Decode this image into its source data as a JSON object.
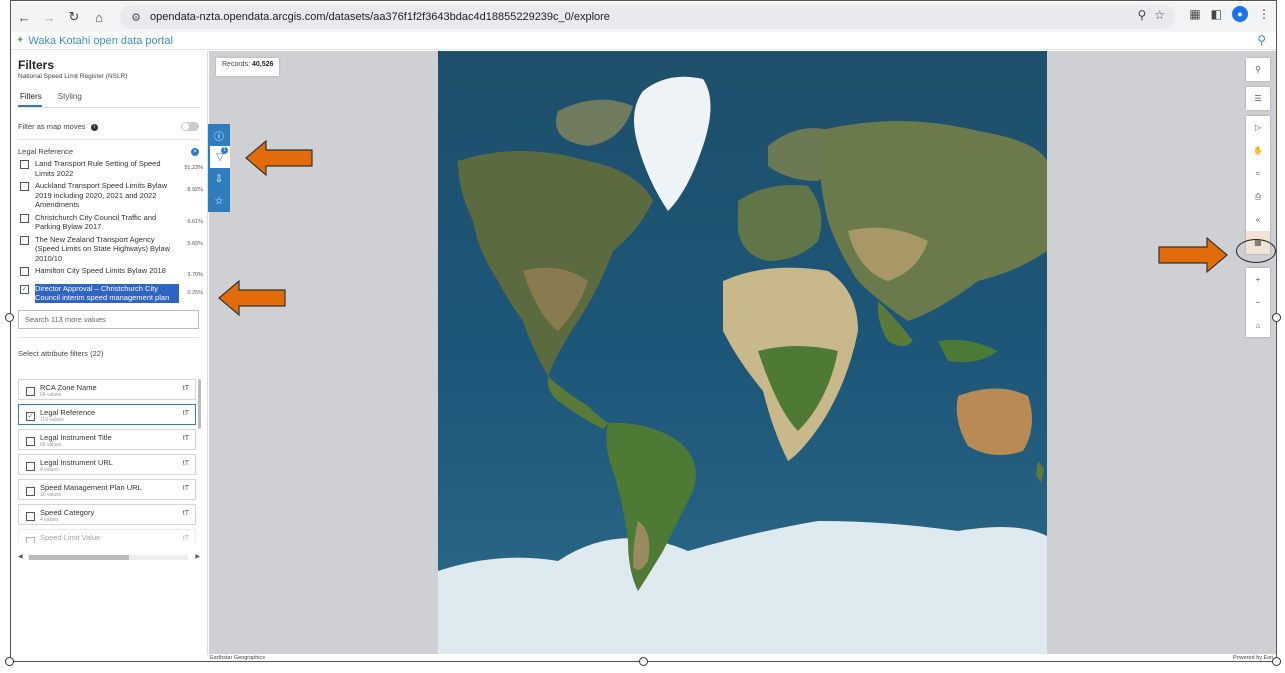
{
  "browser": {
    "url": "opendata-nzta.opendata.arcgis.com/datasets/aa376f1f2f3643bdac4d18855229239c_0/explore",
    "icons": [
      "back-icon",
      "forward-icon",
      "reload-icon",
      "home-icon",
      "site-settings-icon",
      "zoom-icon",
      "star-icon",
      "extensions-icon",
      "sidepanel-icon",
      "profile-icon",
      "menu-icon"
    ]
  },
  "portal": {
    "title": "Waka Kotahi open data portal"
  },
  "panel": {
    "title": "Filters",
    "subtitle": "National Speed Limit Register (NSLR)",
    "tabs": [
      {
        "label": "Filters",
        "active": true
      },
      {
        "label": "Styling",
        "active": false
      }
    ],
    "filter_as_map_moves": "Filter as map moves",
    "legal_reference": {
      "title": "Legal Reference",
      "options": [
        {
          "label": "Land Transport Rule Setting of Speed Limits 2022",
          "pct": "51.23%",
          "checked": false,
          "selected": false
        },
        {
          "label": "Auckland Transport Speed Limits Bylaw 2019 including 2020, 2021 and 2022 Amendments",
          "pct": "8.92%",
          "checked": false,
          "selected": false
        },
        {
          "label": "Christchurch City Council Traffic and Parking Bylaw 2017",
          "pct": "6.61%",
          "checked": false,
          "selected": false
        },
        {
          "label": "The New Zealand Transport Agency (Speed Limits on State Highways) Bylaw 2010/10",
          "pct": "5.60%",
          "checked": false,
          "selected": false
        },
        {
          "label": "Hamilton City Speed Limits Bylaw 2018",
          "pct": "3.70%",
          "checked": false,
          "selected": false
        },
        {
          "label": "Director Approval – Christchurch City Council interim speed management plan",
          "pct": "0.25%",
          "checked": true,
          "selected": true
        }
      ],
      "search_placeholder": "Search 113 more values"
    },
    "attribute_filters": {
      "title": "Select attribute filters (22)",
      "items": [
        {
          "name": "RCA Zone Name",
          "count": "68 values",
          "checked": false
        },
        {
          "name": "Legal Reference",
          "count": "119 values",
          "checked": true
        },
        {
          "name": "Legal Instrument Title",
          "count": "66 values",
          "checked": false
        },
        {
          "name": "Legal Instrument URL",
          "count": "4 values",
          "checked": false
        },
        {
          "name": "Speed Management Plan URL",
          "count": "10 values",
          "checked": false
        },
        {
          "name": "Speed Category",
          "count": "4 values",
          "checked": false
        },
        {
          "name": "Speed Limit Value",
          "count": "",
          "checked": false
        }
      ],
      "type_icon": "tT"
    }
  },
  "actionbar": {
    "icons": [
      "info-icon",
      "filter-icon",
      "download-icon",
      "star-icon"
    ],
    "filter_badge": "1"
  },
  "map": {
    "records_label": "Records:",
    "records_value": "40,526",
    "attribution_left": "Earthstar Geographics",
    "attribution_right": "Powered by Esri",
    "tools": {
      "top": [
        "search-icon",
        "legend-icon"
      ],
      "middle": [
        "select-icon",
        "pan-icon",
        "measure-icon",
        "print-icon",
        "collapse-icon",
        "table-icon"
      ],
      "zoom": [
        "+",
        "−",
        "home-icon"
      ]
    }
  },
  "colors": {
    "accent": "#2f7dbf",
    "arrow": "#e36c0a",
    "selection": "#2f63c4"
  }
}
